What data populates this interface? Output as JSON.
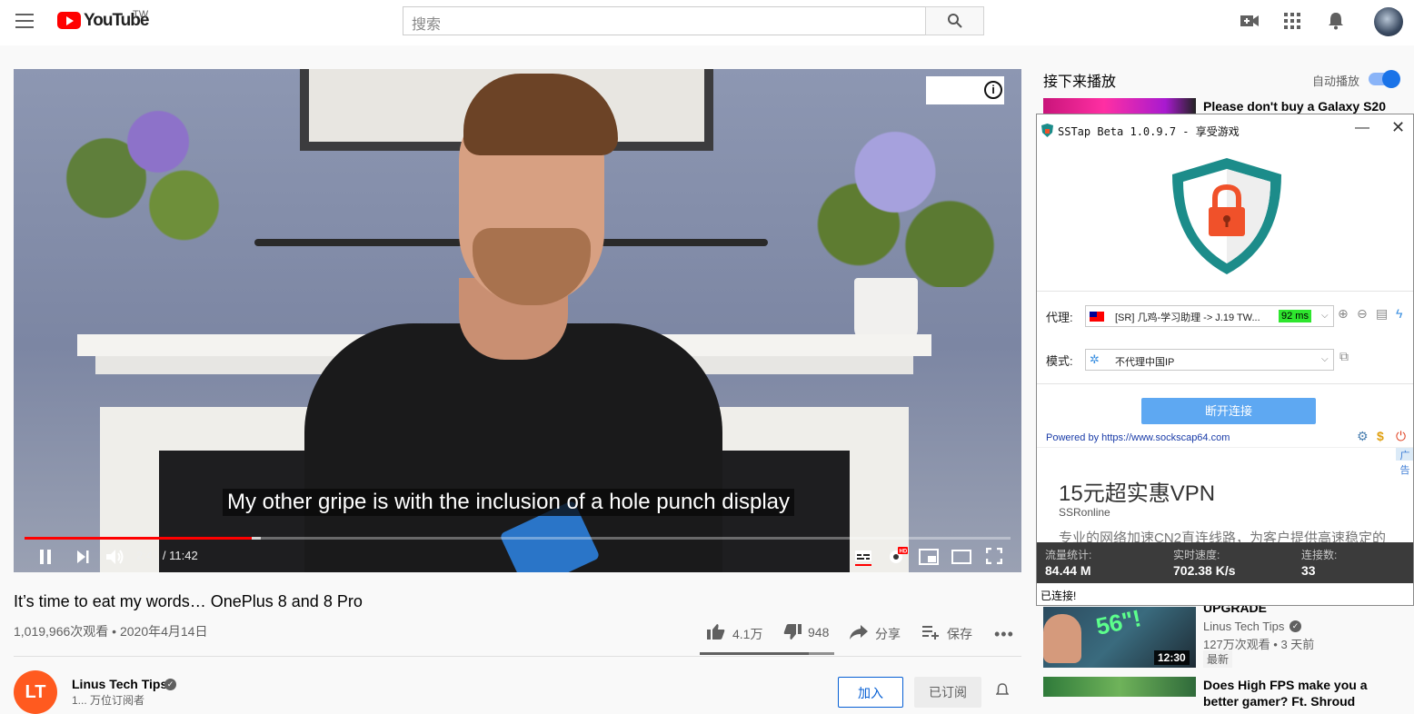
{
  "header": {
    "logo_text": "YouTube",
    "country": "TW",
    "search_placeholder": "搜索",
    "icons": [
      "menu-icon",
      "search-icon",
      "create-video-icon",
      "apps-grid-icon",
      "notifications-bell-icon",
      "user-avatar"
    ]
  },
  "player": {
    "caption": "My other gripe is with the inclusion of a hole punch display",
    "time": "2:41 / 11:42",
    "progress": 0.23,
    "icons": [
      "play-pause-icon",
      "next-icon",
      "volume-icon",
      "subtitles-icon",
      "settings-hd-icon",
      "miniplayer-icon",
      "theater-icon",
      "fullscreen-icon",
      "info-icon"
    ]
  },
  "video": {
    "title": "It’s time to eat my words… OnePlus 8 and 8 Pro",
    "views_date": "1,019,966次观看 • 2020年4月14日",
    "likes": "4.1万",
    "dislikes": "948",
    "share": "分享",
    "save": "保存",
    "like_ratio": 0.81
  },
  "channel": {
    "name": "Linus Tech Tips",
    "subscribers": "1... 万位订阅者",
    "join": "加入",
    "subscribed": "已订阅",
    "avatar_text": "LT"
  },
  "sidebar": {
    "up_next": "接下来播放",
    "autoplay": "自动播放",
    "recs": [
      {
        "title": "Please don't buy a Galaxy S20"
      },
      {
        "title_partial": "UPGRADE",
        "channel": "Linus Tech Tips",
        "meta": "127万次观看 • 3 天前",
        "badge": "最新",
        "duration": "12:30",
        "thumb_text": "56\"!"
      },
      {
        "title": "Does High FPS make you a",
        "title_line2": "better gamer? Ft. Shroud"
      }
    ]
  },
  "sstap": {
    "title": "SSTap Beta 1.0.9.7 - 享受游戏",
    "proxy_label": "代理:",
    "proxy_value": "[SR] 几鸡-学习助理 -> J.19 TW...",
    "ping": "92 ms",
    "mode_label": "模式:",
    "mode_value": "不代理中国IP",
    "disconnect": "断开连接",
    "powered_prefix": "Powered by ",
    "powered_url": "https://www.sockscap64.com",
    "ad": {
      "badge": "广告",
      "headline": "15元超实惠VPN",
      "source": "SSRonline",
      "desc": "专业的网络加速CN2直连线路，为客户提供高速稳定的"
    },
    "stats": [
      {
        "label": "流量统计:",
        "value": "84.44 M"
      },
      {
        "label": "实时速度:",
        "value": "702.38 K/s"
      },
      {
        "label": "连接数:",
        "value": "33"
      }
    ],
    "status": "已连接!",
    "colors": {
      "shield_teal": "#1c8c8a",
      "lock_orange": "#f0512a",
      "button_blue": "#5ea8f2",
      "ping_green": "#2ee62e"
    }
  }
}
